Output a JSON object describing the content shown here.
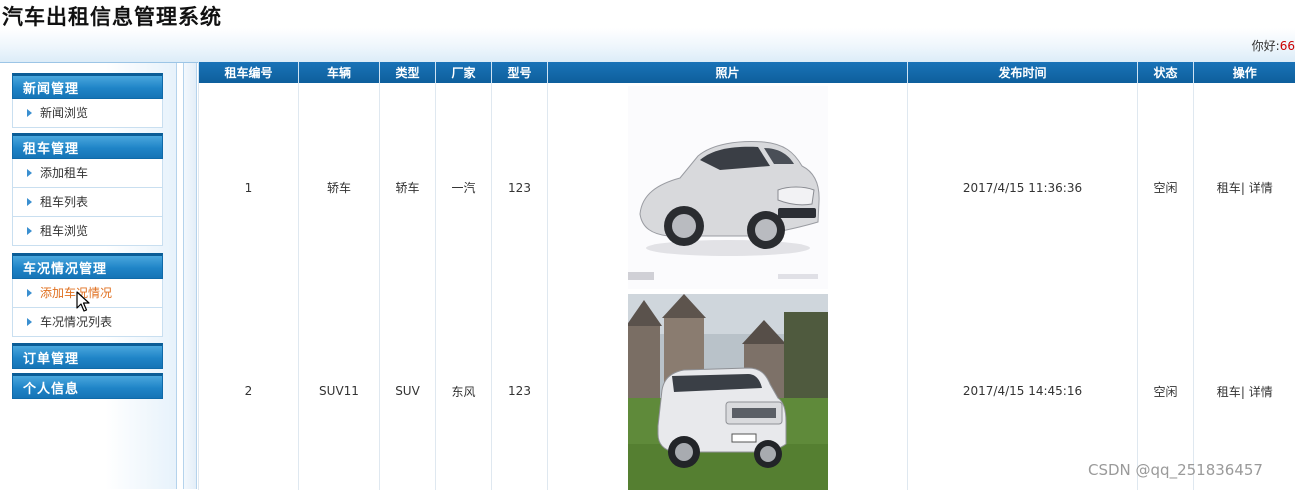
{
  "app": {
    "title": "汽车出租信息管理系统"
  },
  "header": {
    "greeting_label": "你好:",
    "username": "66"
  },
  "sidebar": {
    "groups": [
      {
        "title": "新闻管理",
        "items": [
          {
            "label": "新闻浏览"
          }
        ]
      },
      {
        "title": "租车管理",
        "items": [
          {
            "label": "添加租车"
          },
          {
            "label": "租车列表"
          },
          {
            "label": "租车浏览"
          }
        ]
      },
      {
        "title": "车况情况管理",
        "items": [
          {
            "label": "添加车况情况"
          },
          {
            "label": "车况情况列表"
          }
        ]
      },
      {
        "title": "订单管理",
        "items": []
      },
      {
        "title": "个人信息",
        "items": []
      }
    ],
    "active_item": "添加车况情况"
  },
  "table": {
    "columns": [
      "租车编号",
      "车辆",
      "类型",
      "厂家",
      "型号",
      "照片",
      "发布时间",
      "状态",
      "操作"
    ],
    "rows": [
      {
        "id": "1",
        "vehicle": "轿车",
        "type": "轿车",
        "maker": "一汽",
        "model": "123",
        "photo": "silver-sedan",
        "published": "2017/4/15 11:36:36",
        "status": "空闲",
        "action_rent": "租车",
        "separator": "|",
        "action_detail": "详情"
      },
      {
        "id": "2",
        "vehicle": "SUV11",
        "type": "SUV",
        "maker": "东风",
        "model": "123",
        "photo": "white-suv",
        "published": "2017/4/15 14:45:16",
        "status": "空闲",
        "action_rent": "租车",
        "separator": "|",
        "action_detail": "详情"
      }
    ]
  },
  "watermark": "CSDN @qq_251836457",
  "colors": {
    "header_blue": "#1a73b8",
    "menu_blue": "#1f84c7",
    "active_orange": "#e07020",
    "username_red": "#cc0000"
  }
}
